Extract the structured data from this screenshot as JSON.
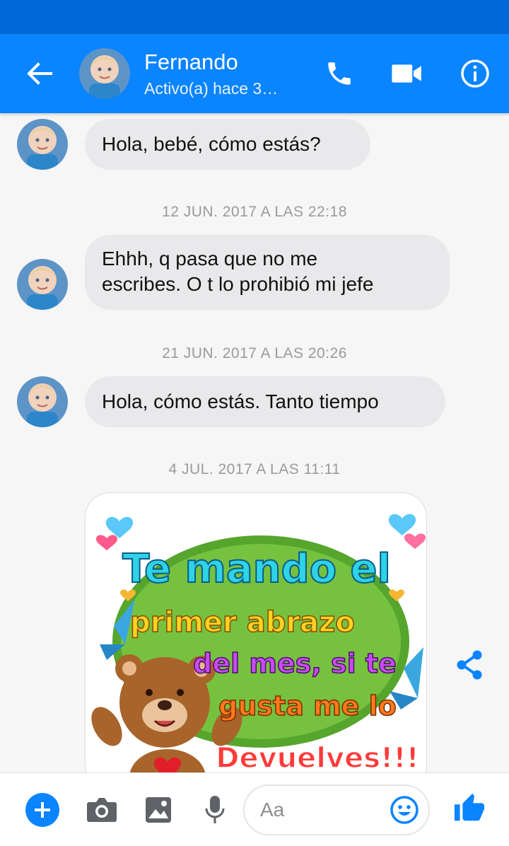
{
  "header": {
    "contact_name": "Fernando",
    "status": "Activo(a) hace 3…",
    "icons": [
      "back-arrow-icon",
      "phone-icon",
      "video-camera-icon",
      "info-icon"
    ]
  },
  "messages": [
    {
      "text": "Hola,  bebé, cómo estás?"
    },
    {
      "timestamp": "12 JUN. 2017 A LAS 22:18"
    },
    {
      "text_line1": "Ehhh, q pasa que no me",
      "text_line2": "escribes.  O t lo prohibió mi jefe"
    },
    {
      "timestamp": "21 JUN. 2017 A LAS 20:26"
    },
    {
      "text": "Hola,  cómo estás. Tanto tiempo"
    },
    {
      "timestamp": "4 JUL. 2017 A LAS 11:11"
    },
    {
      "image_text": [
        "Te mando el",
        "primer abrazo",
        "del mes, si te",
        "gusta me lo",
        "Devuelves!!!"
      ]
    }
  ],
  "composer": {
    "placeholder": "Aa",
    "icons": [
      "plus-icon",
      "camera-icon",
      "gallery-icon",
      "microphone-icon",
      "emoji-icon",
      "thumbs-up-icon"
    ]
  },
  "colors": {
    "brand": "#0a84ff",
    "status_bar": "#0068d6",
    "bubble": "#e9e9eb"
  }
}
